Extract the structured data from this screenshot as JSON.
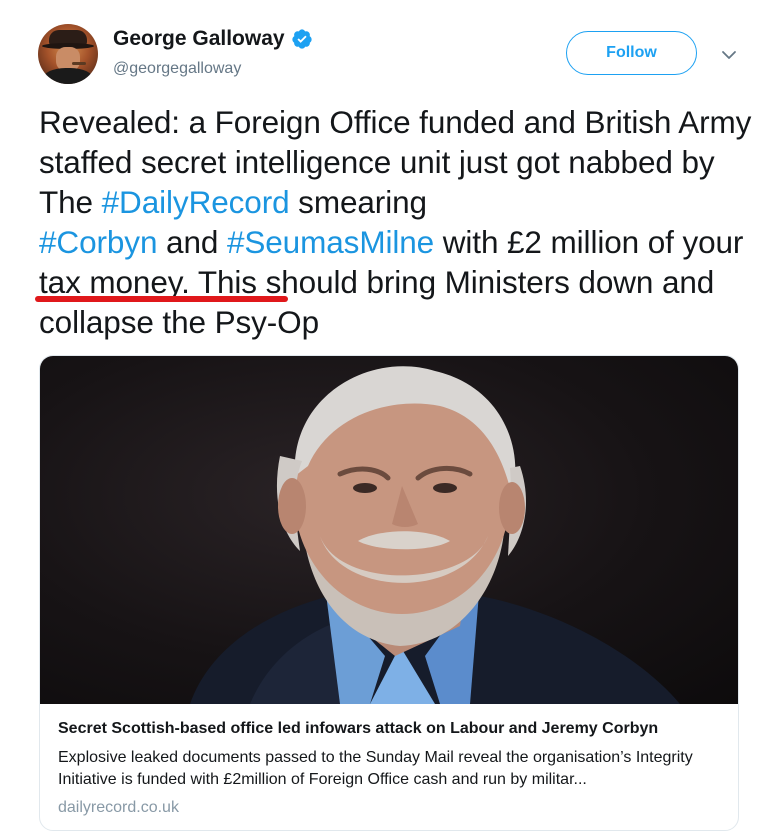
{
  "author": {
    "display_name": "George Galloway",
    "handle": "@georgegalloway",
    "verified": true
  },
  "follow_button_label": "Follow",
  "tweet": {
    "segments": {
      "s1": "Revealed: a Foreign Office funded and British Army staffed secret intelligence unit just got nabbed by The ",
      "h1": "#DailyRecord",
      "s2": " smearing ",
      "h2": "#Corbyn",
      "s3": " and ",
      "h3": "#SeumasMilne",
      "s4": " with £2 million of your tax money. This should bring Ministers down and collapse the Psy-Op"
    }
  },
  "link_card": {
    "title": "Secret Scottish-based office led infowars attack on Labour and Jeremy Corbyn",
    "description": "Explosive leaked documents passed to the Sunday Mail reveal the organisation’s Integrity Initiative is funded with £2million of Foreign Office cash and run by militar...",
    "domain": "dailyrecord.co.uk"
  },
  "colors": {
    "link_blue": "#1b95e0",
    "follow_blue": "#1da1f2",
    "annotation_red": "#e0181b",
    "muted_gray": "#657786"
  },
  "icons": {
    "verified": "verified-badge-icon",
    "more": "chevron-down-icon"
  }
}
